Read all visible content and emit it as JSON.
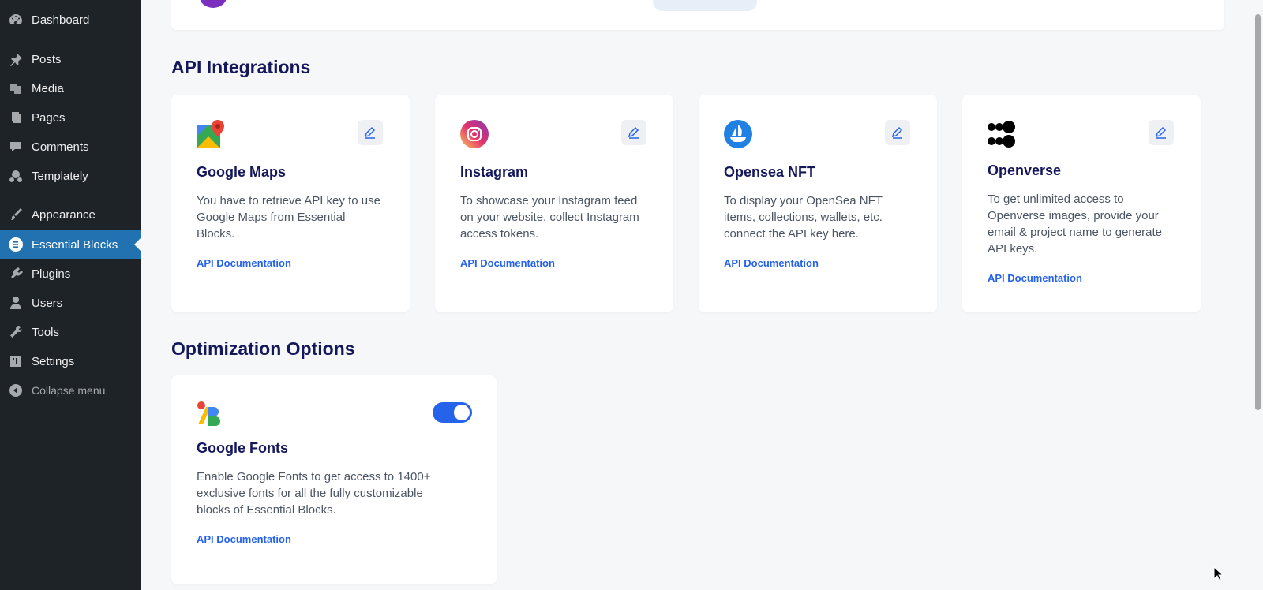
{
  "sidebar": {
    "items": [
      {
        "label": "Dashboard",
        "icon": "dashboard-icon"
      },
      {
        "label": "Posts",
        "icon": "pin-icon"
      },
      {
        "label": "Media",
        "icon": "media-icon"
      },
      {
        "label": "Pages",
        "icon": "pages-icon"
      },
      {
        "label": "Comments",
        "icon": "comment-icon"
      },
      {
        "label": "Templately",
        "icon": "templately-icon"
      },
      {
        "label": "Appearance",
        "icon": "brush-icon"
      },
      {
        "label": "Essential Blocks",
        "icon": "essential-blocks-icon",
        "active": true
      },
      {
        "label": "Plugins",
        "icon": "plugin-icon"
      },
      {
        "label": "Users",
        "icon": "user-icon"
      },
      {
        "label": "Tools",
        "icon": "wrench-icon"
      },
      {
        "label": "Settings",
        "icon": "settings-icon"
      }
    ],
    "collapse_label": "Collapse menu"
  },
  "api_section": {
    "title": "API Integrations",
    "cards": [
      {
        "title": "Google Maps",
        "description": "You have to retrieve API key to use Google Maps from Essential Blocks.",
        "link": "API Documentation",
        "logo": "google-maps-logo"
      },
      {
        "title": "Instagram",
        "description": "To showcase your Instagram feed on your website, collect Instagram access tokens.",
        "link": "API Documentation",
        "logo": "instagram-logo"
      },
      {
        "title": "Opensea NFT",
        "description": "To display your OpenSea NFT items, collections, wallets, etc. connect the API key here.",
        "link": "API Documentation",
        "logo": "opensea-logo"
      },
      {
        "title": "Openverse",
        "description": "To get unlimited access to Openverse images, provide your email & project name to generate API keys.",
        "link": "API Documentation",
        "logo": "openverse-logo"
      }
    ]
  },
  "optimization_section": {
    "title": "Optimization Options",
    "cards": [
      {
        "title": "Google Fonts",
        "description": "Enable Google Fonts to get access to 1400+ exclusive fonts for all the fully customizable blocks of Essential Blocks.",
        "link": "API Documentation",
        "logo": "google-fonts-logo",
        "enabled": true
      }
    ]
  },
  "colors": {
    "sidebar_bg": "#1d2327",
    "active_menu": "#2271b1",
    "heading": "#14175a",
    "link": "#2563eb",
    "toggle_on": "#2563eb"
  }
}
